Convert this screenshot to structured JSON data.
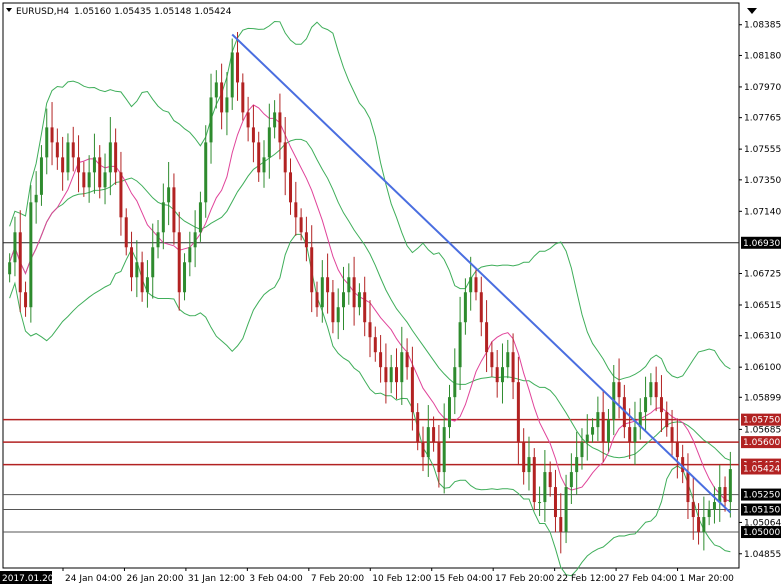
{
  "header": {
    "symbol": "EURUSD,H4",
    "quote": "1.05160 1.05435 1.05148 1.05424"
  },
  "colors": {
    "bull": "#2e8b2e",
    "bear": "#b22222",
    "bands": "#3fae5a",
    "ma": "#e0449a",
    "trendline": "#4a6ee0",
    "level_red": "#b22222",
    "level_gray": "#555555",
    "level_black": "#222222",
    "tag_red": "#b22222",
    "tag_black": "#000000"
  },
  "chart_data": {
    "type": "candlestick",
    "title": "",
    "ylim": [
      1.0476,
      1.0853
    ],
    "y_ticks": [
      "1.08385",
      "1.08180",
      "1.07970",
      "1.07765",
      "1.07555",
      "1.07350",
      "1.07140",
      "1.06725",
      "1.06515",
      "1.06310",
      "1.06100",
      "1.05899",
      "1.05685",
      "1.05064",
      "1.04855"
    ],
    "x_ticks": [
      "24 Jan 04:00",
      "26 Jan 20:00",
      "31 Jan 12:00",
      "3 Feb 04:00",
      "7 Feb 20:00",
      "10 Feb 12:00",
      "15 Feb 04:00",
      "17 Feb 20:00",
      "22 Feb 12:00",
      "27 Feb 04:00",
      "1 Mar 20:00"
    ],
    "x_start_label": "2017.01.20 00:00",
    "levels": [
      {
        "label": "1.06930",
        "value": 1.0693,
        "style": "black"
      },
      {
        "label": "1.05750",
        "value": 1.0575,
        "style": "red"
      },
      {
        "label": "1.05600",
        "value": 1.056,
        "style": "red"
      },
      {
        "label": "1.05450",
        "value": 1.0545,
        "style": "red"
      },
      {
        "label": "1.05250",
        "value": 1.0525,
        "style": "gray"
      },
      {
        "label": "1.05150",
        "value": 1.0515,
        "style": "gray"
      },
      {
        "label": "1.05000",
        "value": 1.05,
        "style": "gray"
      }
    ],
    "current_price_label": "1.05424",
    "current_price": 1.05424,
    "trendline": {
      "from": {
        "bar": 42,
        "price": 1.0832
      },
      "to": {
        "bar": 136,
        "price": 1.0513
      }
    },
    "close": [
      1.068,
      1.07,
      1.066,
      1.065,
      1.072,
      1.0725,
      1.075,
      1.077,
      1.076,
      1.075,
      1.074,
      1.076,
      1.075,
      1.074,
      1.073,
      1.074,
      1.075,
      1.073,
      1.074,
      1.076,
      1.074,
      1.071,
      1.069,
      1.067,
      1.068,
      1.066,
      1.067,
      1.069,
      1.07,
      1.072,
      1.073,
      1.07,
      1.066,
      1.068,
      1.069,
      1.07,
      1.072,
      1.076,
      1.079,
      1.08,
      1.078,
      1.079,
      1.082,
      1.08,
      1.078,
      1.077,
      1.076,
      1.074,
      1.075,
      1.077,
      1.078,
      1.076,
      1.074,
      1.072,
      1.071,
      1.07,
      1.069,
      1.066,
      1.065,
      1.067,
      1.066,
      1.064,
      1.065,
      1.066,
      1.067,
      1.065,
      1.066,
      1.064,
      1.063,
      1.062,
      1.061,
      1.06,
      1.061,
      1.06,
      1.062,
      1.061,
      1.058,
      1.056,
      1.055,
      1.057,
      1.056,
      1.054,
      1.057,
      1.059,
      1.061,
      1.064,
      1.066,
      1.067,
      1.066,
      1.064,
      1.062,
      1.061,
      1.06,
      1.061,
      1.062,
      1.06,
      1.056,
      1.054,
      1.055,
      1.052,
      1.052,
      1.054,
      1.053,
      1.051,
      1.05,
      1.053,
      1.054,
      1.055,
      1.056,
      1.0565,
      1.057,
      1.058,
      1.056,
      1.0575,
      1.06,
      1.059,
      1.057,
      1.056,
      1.057,
      1.058,
      1.059,
      1.06,
      1.059,
      1.058,
      1.057,
      1.056,
      1.055,
      1.054,
      1.052,
      1.051,
      1.05,
      1.051,
      1.0515,
      1.052,
      1.053,
      1.052,
      1.0542
    ],
    "bb_period": 20,
    "ma_period": 10
  }
}
